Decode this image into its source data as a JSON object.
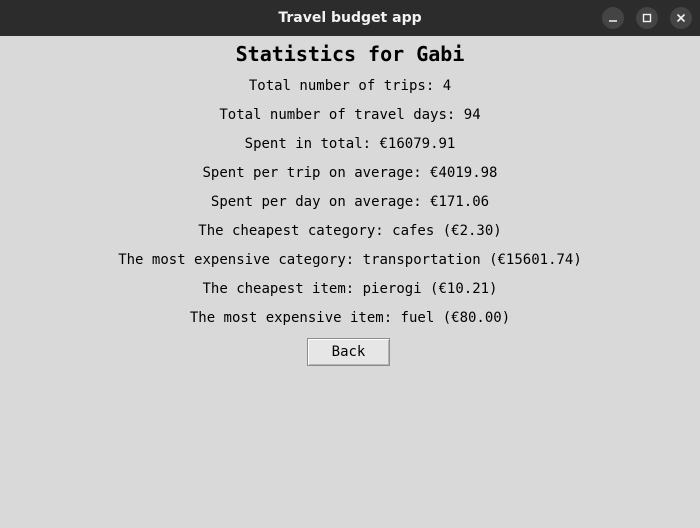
{
  "window": {
    "title": "Travel budget app",
    "controls": [
      "minimize-icon",
      "maximize-icon",
      "close-icon"
    ]
  },
  "stats": {
    "heading": "Statistics for Gabi",
    "total_trips": "Total number of trips: 4",
    "total_days": "Total number of travel days: 94",
    "spent_total": "Spent in total: €16079.91",
    "per_trip": "Spent per trip on average: €4019.98",
    "per_day": "Spent per day on average: €171.06",
    "cheapest_category": "The cheapest category: cafes (€2.30)",
    "most_expensive_category": "The most expensive category: transportation (€15601.74)",
    "cheapest_item": "The cheapest item: pierogi (€10.21)",
    "most_expensive_item": "The most expensive item: fuel (€80.00)"
  },
  "actions": {
    "back_label": "Back"
  },
  "colors": {
    "titlebar": "#2c2c2c",
    "window_bg": "#d9d9d9",
    "button_bg": "#e6e6e6"
  }
}
